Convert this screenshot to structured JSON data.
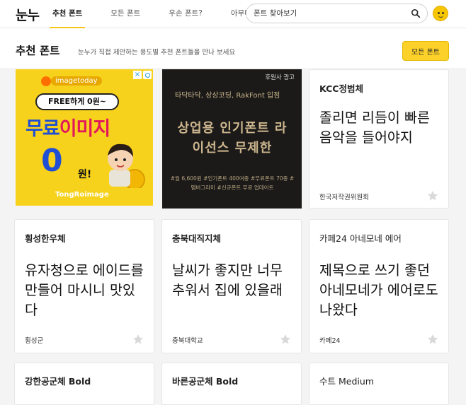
{
  "header": {
    "logo": "눈누",
    "nav": [
      "추천 폰트",
      "모든 폰트",
      "우손 폰트?",
      "아무디자인"
    ],
    "search_placeholder": "폰트 찾아보기"
  },
  "section": {
    "title": "추천 폰트",
    "subtitle": "눈누가 직접 제안하는 용도별 추천 폰트들을 만나 보세요",
    "all_button": "모든 폰트"
  },
  "ads": {
    "ad1": {
      "brand": "imagetoday",
      "pill": "FREE하게 0원~",
      "headline_a": "무료",
      "headline_b": "이미지",
      "zero": "0",
      "won": "원!",
      "brand2": "TongRoimage"
    },
    "ad2": {
      "tag": "후원사 광고",
      "line1": "타닥타닥, 상상코딩, RakFont 입점",
      "line2": "상업용 인기폰트 라이선스 무제한",
      "line3": "#월 6,600원 #인기폰트 400여종 #무료폰트 70종 #멤버그라미 #신규폰트 무료 업데이트"
    }
  },
  "cards": [
    {
      "name": "KCC정범체",
      "sample": "졸리면 리듬이 빠른 음악을 들어야지",
      "maker": "한국저작권위원회"
    },
    {
      "name": "횡성한우체",
      "sample": "유자청으로 에이드를 만들어 마시니 맛있다",
      "maker": "횡성군"
    },
    {
      "name": "충북대직지체",
      "sample": "날씨가 좋지만 너무 추워서 집에 있을래",
      "maker": "충북대학교"
    },
    {
      "name": "카페24 아네모네 에어",
      "sample": "제목으로 쓰기 좋던 아네모네가 에어로도 나왔다",
      "maker": "카페24"
    },
    {
      "name": "강한공군체 Bold"
    },
    {
      "name": "바른공군체 Bold"
    },
    {
      "name": "수트 Medium"
    }
  ],
  "colors": {
    "accent": "#fcd12a",
    "star": "#d9d9d9"
  }
}
